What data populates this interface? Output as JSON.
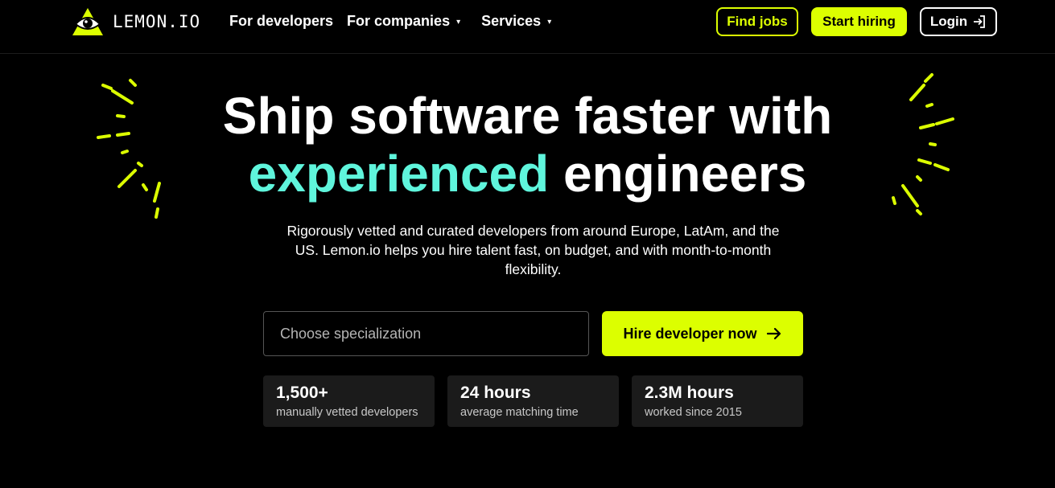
{
  "brand": {
    "logo_text": "LEMON.IO",
    "accent_color": "#dcff00",
    "highlight_color": "#5ff5dc"
  },
  "nav": {
    "items": [
      {
        "label": "For developers",
        "has_dropdown": false
      },
      {
        "label": "For companies",
        "has_dropdown": true
      },
      {
        "label": "Services",
        "has_dropdown": true
      }
    ],
    "caret_icon": "▾"
  },
  "header_actions": {
    "find_jobs": "Find jobs",
    "start_hiring": "Start hiring",
    "login": "Login",
    "login_icon": "login-arrow-icon"
  },
  "hero": {
    "title_line1": "Ship software faster with",
    "title_accent": "experienced",
    "title_line2_rest": " engineers",
    "subtitle": "Rigorously vetted and curated developers from around Europe, LatAm, and the US. Lemon.io helps you hire talent fast, on budget, and with month-to-month flexibility."
  },
  "search": {
    "placeholder": "Choose specialization",
    "cta": "Hire developer now",
    "cta_icon": "arrow-right-icon"
  },
  "stats": [
    {
      "value": "1,500+",
      "label": "manually vetted developers"
    },
    {
      "value": "24 hours",
      "label": "average matching time"
    },
    {
      "value": "2.3M hours",
      "label": "worked since 2015"
    }
  ]
}
